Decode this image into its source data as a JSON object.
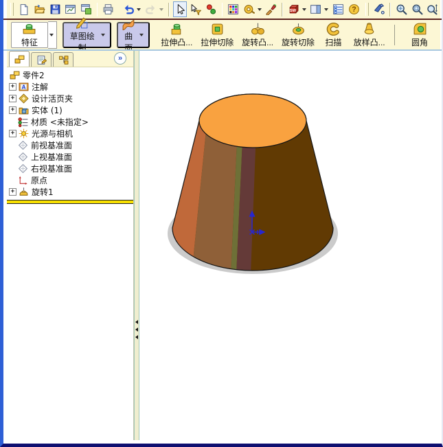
{
  "toolbar_main": {
    "buttons": [
      "new-document",
      "open",
      "save",
      "make-drawing-from-part",
      "make-assembly-from-part",
      "print",
      "undo",
      "redo",
      "select",
      "select-filter",
      "selection-filter-toggle",
      "edit-color",
      "measure",
      "appearance",
      "solidworks-resources",
      "task-pane",
      "options",
      "help",
      "view-orientation",
      "zoom-to-fit",
      "zoom-to-area",
      "zoom-in-out"
    ]
  },
  "feature_toolbar": {
    "groups": [
      {
        "label": "特征"
      },
      {
        "label": "草图绘制"
      },
      {
        "label": "曲面"
      }
    ],
    "commands": [
      {
        "label": "拉伸凸..."
      },
      {
        "label": "拉伸切除"
      },
      {
        "label": "旋转凸..."
      },
      {
        "label": "旋转切除"
      },
      {
        "label": "扫描"
      },
      {
        "label": "放样凸..."
      },
      {
        "label": "圆角"
      }
    ]
  },
  "panel": {
    "collapse_chevrons": "»"
  },
  "feature_tree": {
    "root_label": "零件2",
    "expand_glyph": "+",
    "items": [
      {
        "label": "注解",
        "icon": "annotations",
        "expandable": true
      },
      {
        "label": "设计活页夹",
        "icon": "design-binder",
        "expandable": true
      },
      {
        "label": "实体 (1)",
        "icon": "solid-bodies-folder",
        "expandable": true
      },
      {
        "label": "材质 <未指定>",
        "icon": "material",
        "expandable": false
      },
      {
        "label": "光源与相机",
        "icon": "lights-cameras",
        "expandable": true
      },
      {
        "label": "前视基准面",
        "icon": "plane",
        "expandable": false
      },
      {
        "label": "上视基准面",
        "icon": "plane",
        "expandable": false
      },
      {
        "label": "右视基准面",
        "icon": "plane",
        "expandable": false
      },
      {
        "label": "原点",
        "icon": "origin",
        "expandable": false
      },
      {
        "label": "旋转1",
        "icon": "revolve-feature",
        "expandable": true
      }
    ]
  },
  "viewport_model": {
    "shape": "revolved truncated cone",
    "top_face_color": "#f9a240",
    "band_colors": [
      "#c0693a",
      "#8f6038",
      "#6e7037",
      "#643a38",
      "#613a03"
    ],
    "shadow_color": "#cbcbcb",
    "origin_triad_color": "#2727cf",
    "outline_color": "#151515"
  },
  "colors": {
    "toolbar_bg": "#fcf7d5",
    "lavender_button": "#c9c9ea",
    "window_border_left": "#2e5fd6",
    "window_border_bottom": "#0f0f70",
    "rollback_bar": "#f8e000",
    "splitter_bg": "#f0eecf"
  }
}
